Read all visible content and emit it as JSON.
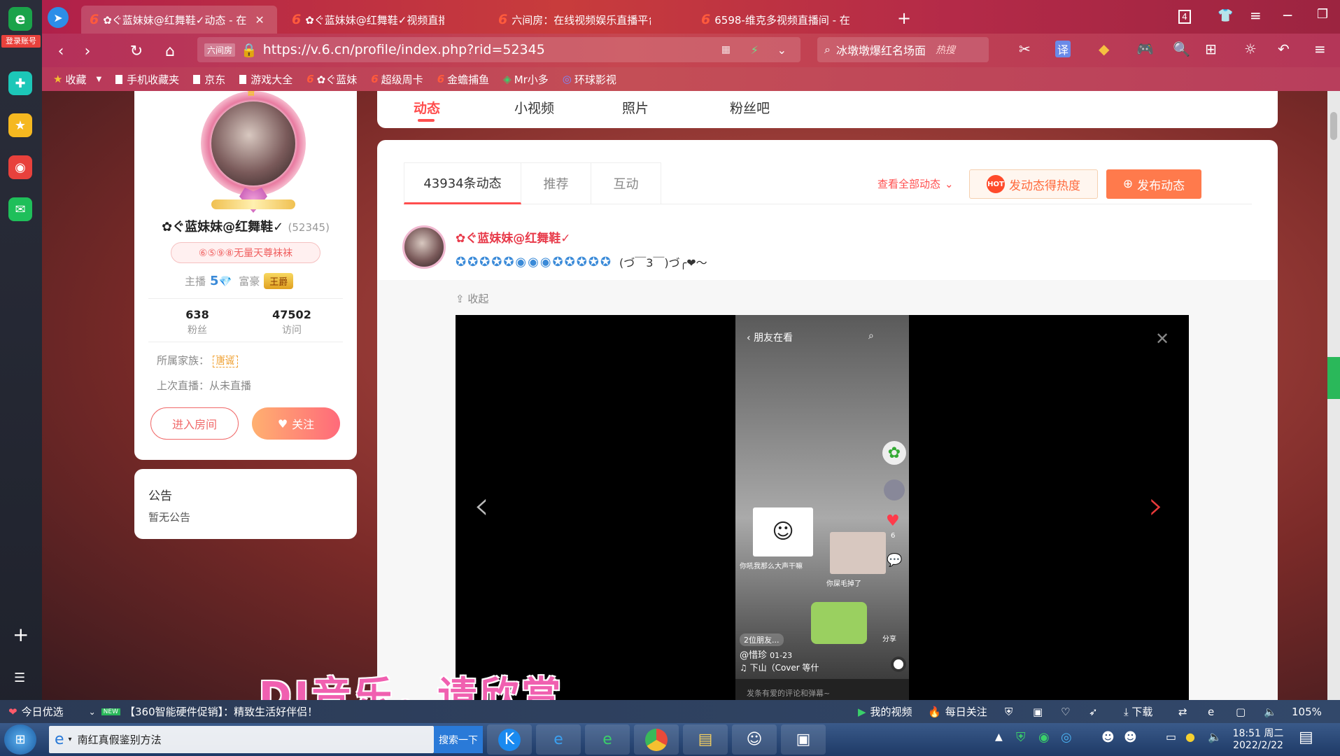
{
  "browser": {
    "tabs": [
      {
        "label": "✿ぐ蓝妹妹@红舞鞋✓动态 - 在"
      },
      {
        "label": "✿ぐ蓝妹妹@红舞鞋✓视频直播"
      },
      {
        "label": "六间房：在线视频娱乐直播平台"
      },
      {
        "label": "6598-维克多视频直播间 - 在"
      }
    ],
    "tab_count": "4",
    "url": "https://v.6.cn/profile/index.php?rid=52345",
    "url_badge": "六间房",
    "search_text": "冰墩墩爆红名场面",
    "search_hot": "热搜",
    "login_label": "登录账号",
    "bookmarks": [
      "收藏",
      "手机收藏夹",
      "京东",
      "游戏大全",
      "✿ぐ蓝妹",
      "超级周卡",
      "金蟾捕鱼",
      "Mr小多",
      "环球影视"
    ]
  },
  "profile": {
    "name": "✿ぐ蓝妹妹@红舞鞋✓",
    "rid": "(52345)",
    "badge": "⑥⑤⑨⑧无量天尊袜袜",
    "anchor_label": "主播",
    "anchor_level": "5",
    "rich_label": "富豪",
    "rich_title": "王爵",
    "fans_count": "638",
    "fans_label": "粉丝",
    "visits_count": "47502",
    "visits_label": "访问",
    "family_label": "所属家族：",
    "family_name": "唐诚",
    "last_live": "上次直播：从未直播",
    "enter_room": "进入房间",
    "follow": "关注"
  },
  "notice": {
    "title": "公告",
    "content": "暂无公告"
  },
  "top_tabs": [
    "动态",
    "小视频",
    "照片",
    "粉丝吧"
  ],
  "feed": {
    "subtabs": [
      "43934条动态",
      "推荐",
      "互动"
    ],
    "view_all": "查看全部动态",
    "hot_btn": "发动态得热度",
    "publish_btn": "发布动态",
    "post_author": "✿ぐ蓝妹妹@红舞鞋✓",
    "post_text": "(づ￣3￣)づ╭❤～",
    "collapse": "收起"
  },
  "video": {
    "top_bar": "朋友在看",
    "caption_left": "你吼我那么大声干嘛",
    "friends": "2位朋友...",
    "user": "@惜珍",
    "date": "01-23",
    "song": "♫ 下山（Cover 等什",
    "comment_placeholder": "发条有爱的评论和弹幕~",
    "like_count": "6",
    "share": "分享",
    "sticker_text": "你屎毛掉了"
  },
  "overlay_text": "DJ音乐，请欣赏",
  "statusbar": {
    "today": "今日优选",
    "promo": "【360智能硬件促销】：精致生活好伴侣！",
    "my_video": "我的视频",
    "daily": "每日关注",
    "download": "下载",
    "zoom": "105%"
  },
  "taskbar": {
    "ie_title": "南红真假鉴别方法",
    "search_btn": "搜索一下",
    "time": "18:51 周二",
    "date": "2022/2/22"
  },
  "colors": {
    "accent": "#ff4e4e",
    "orange": "#ff7a3c",
    "brand_red": "#e83a4a"
  }
}
